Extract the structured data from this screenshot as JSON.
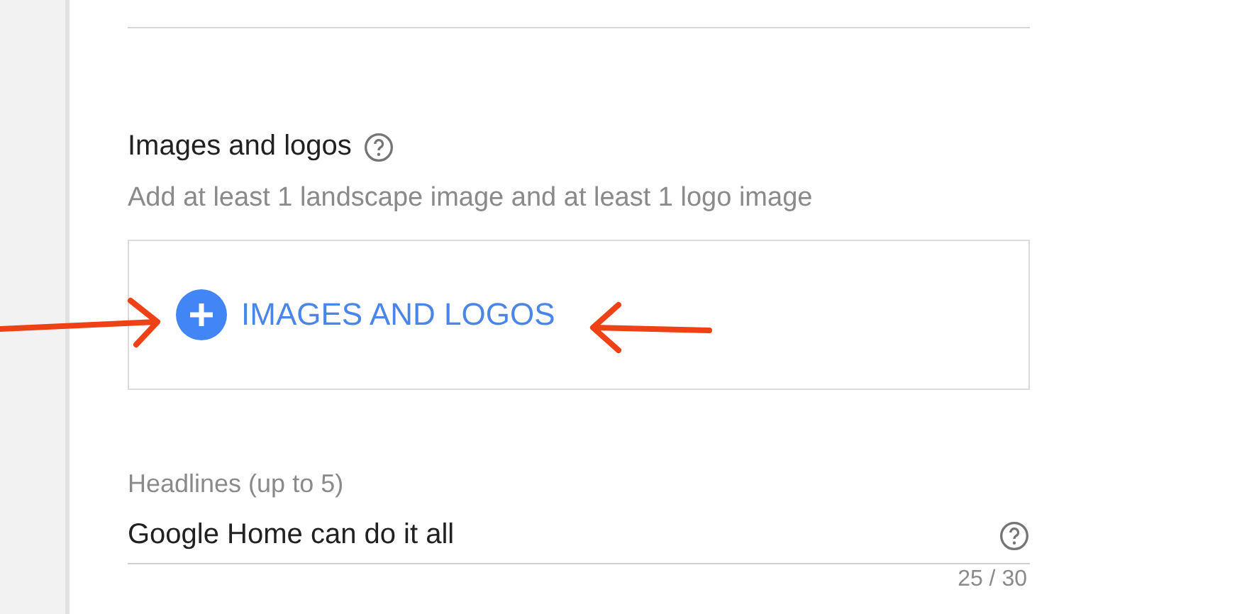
{
  "images_section": {
    "title": "Images and logos",
    "description": "Add at least 1 landscape image and at least 1 logo image",
    "add_button": "IMAGES AND LOGOS"
  },
  "headlines": {
    "label": "Headlines (up to 5)",
    "value": "Google Home can do it all",
    "counter": "25 / 30"
  }
}
